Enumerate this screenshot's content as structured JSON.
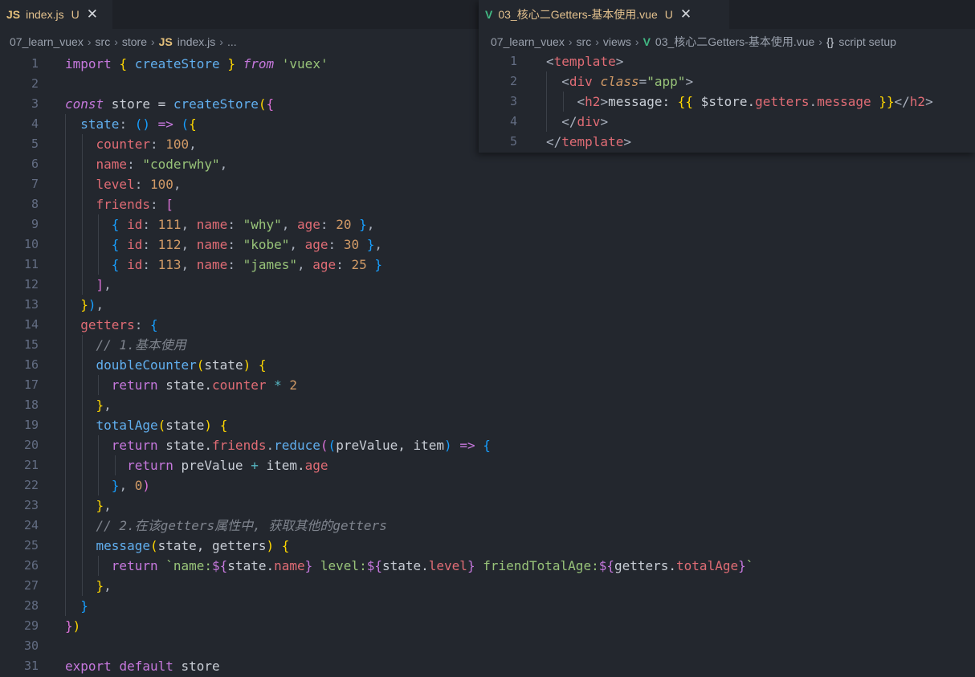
{
  "left_editor": {
    "tab": {
      "icon": "JS",
      "name": "index.js",
      "status": "U",
      "close": "✕"
    },
    "breadcrumb": [
      "07_learn_vuex",
      "src",
      "store",
      "index.js",
      "..."
    ],
    "breadcrumb_file_icon": "JS",
    "lines": [
      {
        "n": "1",
        "tokens": [
          [
            "kw",
            "import"
          ],
          [
            "p",
            " "
          ],
          [
            "b1",
            "{"
          ],
          [
            "p",
            " "
          ],
          [
            "fn",
            "createStore"
          ],
          [
            "p",
            " "
          ],
          [
            "b1",
            "}"
          ],
          [
            "p",
            " "
          ],
          [
            "kwi",
            "from"
          ],
          [
            "p",
            " "
          ],
          [
            "str",
            "'vuex'"
          ]
        ]
      },
      {
        "n": "2",
        "tokens": []
      },
      {
        "n": "3",
        "tokens": [
          [
            "kwi",
            "const"
          ],
          [
            "p",
            " store = "
          ],
          [
            "fn",
            "createStore"
          ],
          [
            "b1",
            "("
          ],
          [
            "b2",
            "{"
          ]
        ]
      },
      {
        "n": "4",
        "tokens": [
          [
            "p",
            "  "
          ],
          [
            "fn",
            "state"
          ],
          [
            "punc",
            ": "
          ],
          [
            "b3",
            "()"
          ],
          [
            "p",
            " "
          ],
          [
            "kw",
            "=>"
          ],
          [
            "p",
            " "
          ],
          [
            "b3",
            "("
          ],
          [
            "b1",
            "{"
          ]
        ]
      },
      {
        "n": "5",
        "tokens": [
          [
            "p",
            "    "
          ],
          [
            "prop",
            "counter"
          ],
          [
            "punc",
            ": "
          ],
          [
            "num",
            "100"
          ],
          [
            "punc",
            ","
          ]
        ]
      },
      {
        "n": "6",
        "tokens": [
          [
            "p",
            "    "
          ],
          [
            "prop",
            "name"
          ],
          [
            "punc",
            ": "
          ],
          [
            "str",
            "\"coderwhy\""
          ],
          [
            "punc",
            ","
          ]
        ]
      },
      {
        "n": "7",
        "tokens": [
          [
            "p",
            "    "
          ],
          [
            "prop",
            "level"
          ],
          [
            "punc",
            ": "
          ],
          [
            "num",
            "100"
          ],
          [
            "punc",
            ","
          ]
        ]
      },
      {
        "n": "8",
        "tokens": [
          [
            "p",
            "    "
          ],
          [
            "prop",
            "friends"
          ],
          [
            "punc",
            ": "
          ],
          [
            "b2",
            "["
          ]
        ]
      },
      {
        "n": "9",
        "tokens": [
          [
            "p",
            "      "
          ],
          [
            "b3",
            "{"
          ],
          [
            "p",
            " "
          ],
          [
            "prop",
            "id"
          ],
          [
            "punc",
            ": "
          ],
          [
            "num",
            "111"
          ],
          [
            "punc",
            ", "
          ],
          [
            "prop",
            "name"
          ],
          [
            "punc",
            ": "
          ],
          [
            "str",
            "\"why\""
          ],
          [
            "punc",
            ", "
          ],
          [
            "prop",
            "age"
          ],
          [
            "punc",
            ": "
          ],
          [
            "num",
            "20"
          ],
          [
            "p",
            " "
          ],
          [
            "b3",
            "}"
          ],
          [
            "punc",
            ","
          ]
        ]
      },
      {
        "n": "10",
        "tokens": [
          [
            "p",
            "      "
          ],
          [
            "b3",
            "{"
          ],
          [
            "p",
            " "
          ],
          [
            "prop",
            "id"
          ],
          [
            "punc",
            ": "
          ],
          [
            "num",
            "112"
          ],
          [
            "punc",
            ", "
          ],
          [
            "prop",
            "name"
          ],
          [
            "punc",
            ": "
          ],
          [
            "str",
            "\"kobe\""
          ],
          [
            "punc",
            ", "
          ],
          [
            "prop",
            "age"
          ],
          [
            "punc",
            ": "
          ],
          [
            "num",
            "30"
          ],
          [
            "p",
            " "
          ],
          [
            "b3",
            "}"
          ],
          [
            "punc",
            ","
          ]
        ]
      },
      {
        "n": "11",
        "tokens": [
          [
            "p",
            "      "
          ],
          [
            "b3",
            "{"
          ],
          [
            "p",
            " "
          ],
          [
            "prop",
            "id"
          ],
          [
            "punc",
            ": "
          ],
          [
            "num",
            "113"
          ],
          [
            "punc",
            ", "
          ],
          [
            "prop",
            "name"
          ],
          [
            "punc",
            ": "
          ],
          [
            "str",
            "\"james\""
          ],
          [
            "punc",
            ", "
          ],
          [
            "prop",
            "age"
          ],
          [
            "punc",
            ": "
          ],
          [
            "num",
            "25"
          ],
          [
            "p",
            " "
          ],
          [
            "b3",
            "}"
          ]
        ]
      },
      {
        "n": "12",
        "tokens": [
          [
            "p",
            "    "
          ],
          [
            "b2",
            "]"
          ],
          [
            "punc",
            ","
          ]
        ]
      },
      {
        "n": "13",
        "tokens": [
          [
            "p",
            "  "
          ],
          [
            "b1",
            "}"
          ],
          [
            "b3",
            ")"
          ],
          [
            "punc",
            ","
          ]
        ]
      },
      {
        "n": "14",
        "tokens": [
          [
            "p",
            "  "
          ],
          [
            "prop",
            "getters"
          ],
          [
            "punc",
            ": "
          ],
          [
            "b3",
            "{"
          ]
        ]
      },
      {
        "n": "15",
        "tokens": [
          [
            "p",
            "    "
          ],
          [
            "cmt",
            "// 1.基本使用"
          ]
        ]
      },
      {
        "n": "16",
        "tokens": [
          [
            "p",
            "    "
          ],
          [
            "fn",
            "doubleCounter"
          ],
          [
            "b1",
            "("
          ],
          [
            "p",
            "state"
          ],
          [
            "b1",
            ")"
          ],
          [
            "p",
            " "
          ],
          [
            "b1",
            "{"
          ]
        ]
      },
      {
        "n": "17",
        "tokens": [
          [
            "p",
            "      "
          ],
          [
            "kw",
            "return"
          ],
          [
            "p",
            " state."
          ],
          [
            "prop",
            "counter"
          ],
          [
            "p",
            " "
          ],
          [
            "op",
            "*"
          ],
          [
            "p",
            " "
          ],
          [
            "num",
            "2"
          ]
        ]
      },
      {
        "n": "18",
        "tokens": [
          [
            "p",
            "    "
          ],
          [
            "b1",
            "}"
          ],
          [
            "punc",
            ","
          ]
        ]
      },
      {
        "n": "19",
        "tokens": [
          [
            "p",
            "    "
          ],
          [
            "fn",
            "totalAge"
          ],
          [
            "b1",
            "("
          ],
          [
            "p",
            "state"
          ],
          [
            "b1",
            ")"
          ],
          [
            "p",
            " "
          ],
          [
            "b1",
            "{"
          ]
        ]
      },
      {
        "n": "20",
        "tokens": [
          [
            "p",
            "      "
          ],
          [
            "kw",
            "return"
          ],
          [
            "p",
            " state."
          ],
          [
            "prop",
            "friends"
          ],
          [
            "punc",
            "."
          ],
          [
            "fn",
            "reduce"
          ],
          [
            "b2",
            "("
          ],
          [
            "b3",
            "("
          ],
          [
            "p",
            "preValue, item"
          ],
          [
            "b3",
            ")"
          ],
          [
            "p",
            " "
          ],
          [
            "kw",
            "=>"
          ],
          [
            "p",
            " "
          ],
          [
            "b3",
            "{"
          ]
        ]
      },
      {
        "n": "21",
        "tokens": [
          [
            "p",
            "        "
          ],
          [
            "kw",
            "return"
          ],
          [
            "p",
            " preValue "
          ],
          [
            "op",
            "+"
          ],
          [
            "p",
            " item."
          ],
          [
            "prop",
            "age"
          ]
        ]
      },
      {
        "n": "22",
        "tokens": [
          [
            "p",
            "      "
          ],
          [
            "b3",
            "}"
          ],
          [
            "punc",
            ", "
          ],
          [
            "num",
            "0"
          ],
          [
            "b2",
            ")"
          ]
        ]
      },
      {
        "n": "23",
        "tokens": [
          [
            "p",
            "    "
          ],
          [
            "b1",
            "}"
          ],
          [
            "punc",
            ","
          ]
        ]
      },
      {
        "n": "24",
        "tokens": [
          [
            "p",
            "    "
          ],
          [
            "cmt",
            "// 2.在该getters属性中, 获取其他的getters"
          ]
        ]
      },
      {
        "n": "25",
        "tokens": [
          [
            "p",
            "    "
          ],
          [
            "fn",
            "message"
          ],
          [
            "b1",
            "("
          ],
          [
            "p",
            "state, getters"
          ],
          [
            "b1",
            ")"
          ],
          [
            "p",
            " "
          ],
          [
            "b1",
            "{"
          ]
        ]
      },
      {
        "n": "26",
        "tokens": [
          [
            "p",
            "      "
          ],
          [
            "kw",
            "return"
          ],
          [
            "p",
            " "
          ],
          [
            "str",
            "`name:"
          ],
          [
            "kw",
            "${"
          ],
          [
            "p",
            "state."
          ],
          [
            "prop",
            "name"
          ],
          [
            "kw",
            "}"
          ],
          [
            "str",
            " level:"
          ],
          [
            "kw",
            "${"
          ],
          [
            "p",
            "state."
          ],
          [
            "prop",
            "level"
          ],
          [
            "kw",
            "}"
          ],
          [
            "str",
            " friendTotalAge:"
          ],
          [
            "kw",
            "${"
          ],
          [
            "p",
            "getters."
          ],
          [
            "prop",
            "totalAge"
          ],
          [
            "kw",
            "}"
          ],
          [
            "str",
            "`"
          ]
        ]
      },
      {
        "n": "27",
        "tokens": [
          [
            "p",
            "    "
          ],
          [
            "b1",
            "}"
          ],
          [
            "punc",
            ","
          ]
        ]
      },
      {
        "n": "28",
        "tokens": [
          [
            "p",
            "  "
          ],
          [
            "b3",
            "}"
          ]
        ]
      },
      {
        "n": "29",
        "tokens": [
          [
            "b2",
            "}"
          ],
          [
            "b1",
            ")"
          ]
        ]
      },
      {
        "n": "30",
        "tokens": []
      },
      {
        "n": "31",
        "tokens": [
          [
            "kw",
            "export"
          ],
          [
            "p",
            " "
          ],
          [
            "kw",
            "default"
          ],
          [
            "p",
            " store"
          ]
        ]
      }
    ]
  },
  "right_editor": {
    "tab": {
      "icon": "V",
      "name": "03_核心二Getters-基本使用.vue",
      "status": "U",
      "close": "✕"
    },
    "breadcrumb": [
      "07_learn_vuex",
      "src",
      "views",
      "03_核心二Getters-基本使用.vue",
      "script setup"
    ],
    "breadcrumb_file_icon": "V",
    "breadcrumb_symbol_icon": "{}",
    "lines": [
      {
        "n": "1",
        "tokens": [
          [
            "br",
            "<"
          ],
          [
            "tag",
            "template"
          ],
          [
            "br",
            ">"
          ]
        ]
      },
      {
        "n": "2",
        "tokens": [
          [
            "p",
            "  "
          ],
          [
            "br",
            "<"
          ],
          [
            "tag",
            "div"
          ],
          [
            "p",
            " "
          ],
          [
            "attr",
            "class"
          ],
          [
            "punc",
            "="
          ],
          [
            "str",
            "\"app\""
          ],
          [
            "br",
            ">"
          ]
        ]
      },
      {
        "n": "3",
        "tokens": [
          [
            "p",
            "    "
          ],
          [
            "br",
            "<"
          ],
          [
            "tag",
            "h2"
          ],
          [
            "br",
            ">"
          ],
          [
            "p",
            "message: "
          ],
          [
            "b1",
            "{{"
          ],
          [
            "p",
            " $store."
          ],
          [
            "prop",
            "getters"
          ],
          [
            "punc",
            "."
          ],
          [
            "prop",
            "message"
          ],
          [
            "p",
            " "
          ],
          [
            "b1",
            "}}"
          ],
          [
            "br",
            "</"
          ],
          [
            "tag",
            "h2"
          ],
          [
            "br",
            ">"
          ]
        ]
      },
      {
        "n": "4",
        "tokens": [
          [
            "p",
            "  "
          ],
          [
            "br",
            "</"
          ],
          [
            "tag",
            "div"
          ],
          [
            "br",
            ">"
          ]
        ]
      },
      {
        "n": "5",
        "tokens": [
          [
            "br",
            "</"
          ],
          [
            "tag",
            "template"
          ],
          [
            "br",
            ">"
          ]
        ]
      }
    ]
  },
  "colors": {
    "background": "#23272e",
    "tabbar": "#1e2127",
    "modified": "#e2c08d",
    "keyword": "#c678dd",
    "function": "#61afef",
    "string": "#98c379",
    "number": "#d19a66",
    "property": "#e06c75",
    "comment": "#7f848e"
  }
}
